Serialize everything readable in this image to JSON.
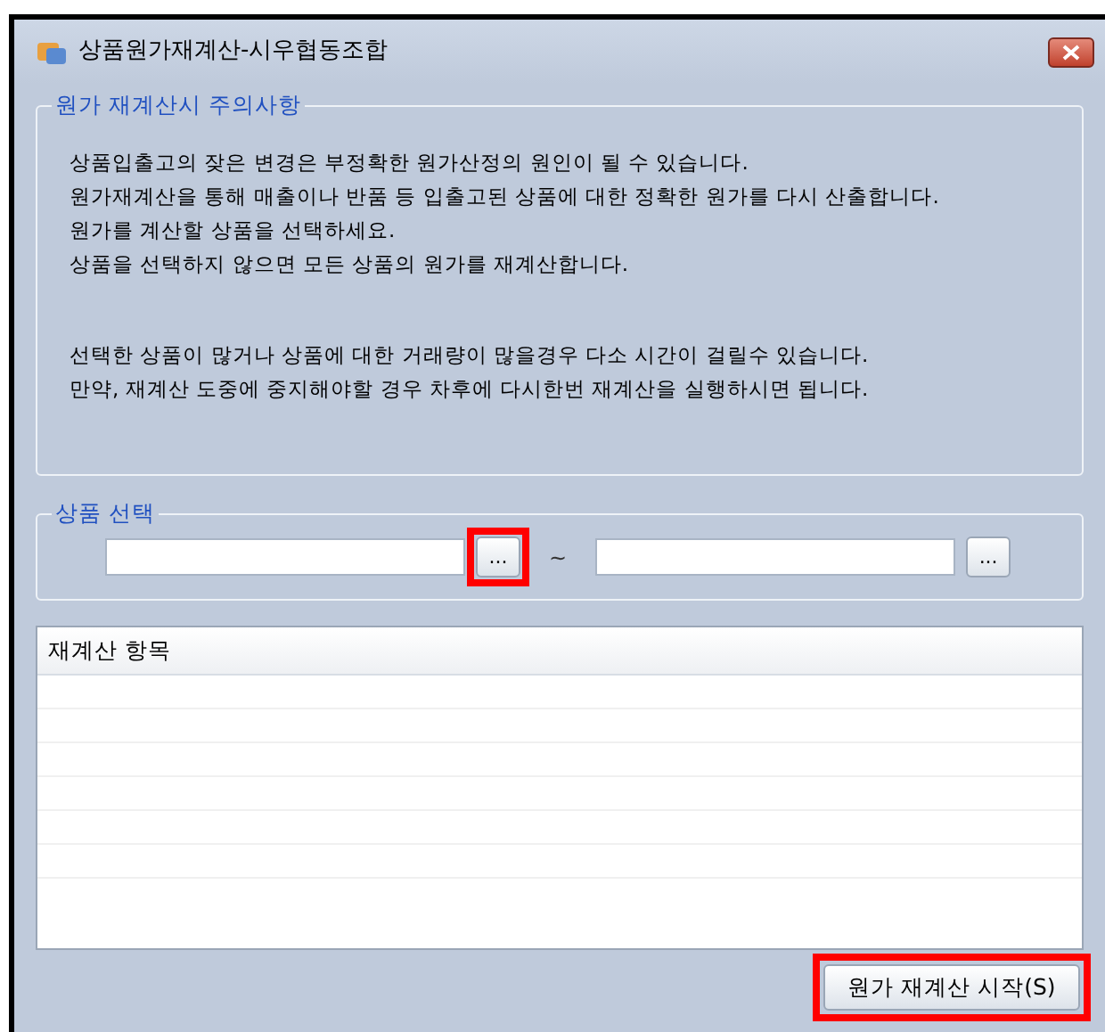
{
  "window": {
    "title": "상품원가재계산-시우협동조합"
  },
  "notice": {
    "title": "원가 재계산시 주의사항",
    "paragraphs": [
      [
        "상품입출고의 잦은 변경은 부정확한 원가산정의 원인이 될 수 있습니다.",
        "원가재계산을 통해 매출이나 반품 등 입출고된 상품에 대한 정확한 원가를 다시 산출합니다.",
        "원가를 계산할 상품을 선택하세요.",
        "상품을 선택하지 않으면 모든 상품의 원가를 재계산합니다."
      ],
      [
        "선택한 상품이 많거나 상품에 대한 거래량이 많을경우 다소 시간이 걸릴수 있습니다.",
        "만약, 재계산 도중에 중지해야할 경우 차후에 다시한번 재계산을 실행하시면 됩니다."
      ]
    ]
  },
  "selection": {
    "title": "상품 선택",
    "separator": "~",
    "fields": [
      {
        "button": "...",
        "highlighted": true
      },
      {
        "button": "...",
        "highlighted": false
      }
    ]
  },
  "list": {
    "header": "재계산 항목"
  },
  "start_button": {
    "label": "원가 재계산 시작(S)",
    "highlighted": true
  }
}
